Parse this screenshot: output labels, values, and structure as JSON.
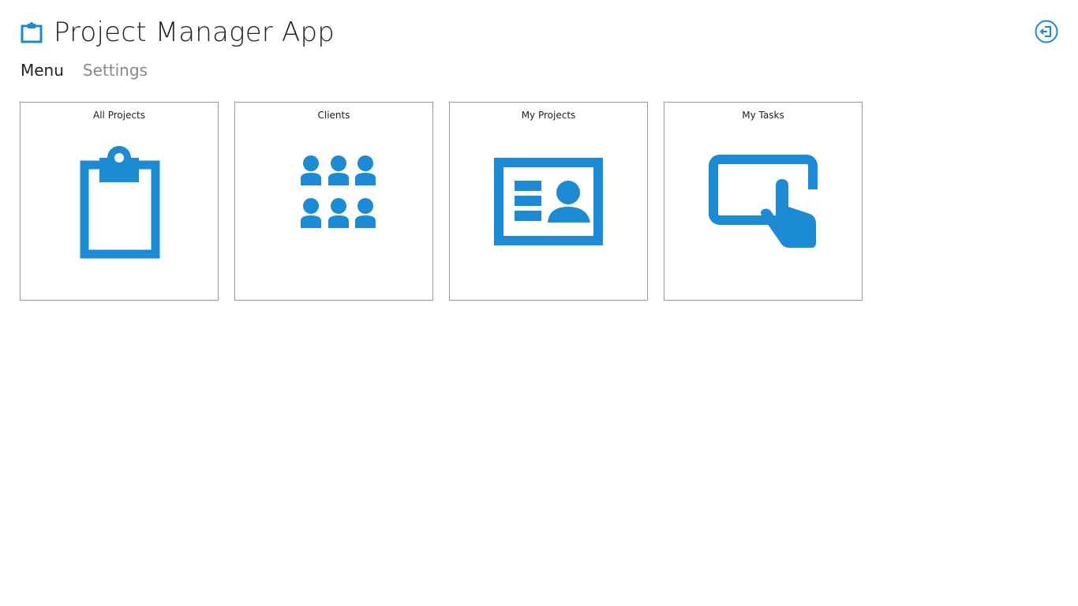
{
  "app": {
    "title": "Project Manager App",
    "accent_color": "#1a8bd4",
    "logo_icon": "clipboard-icon"
  },
  "nav": {
    "items": [
      {
        "label": "Menu",
        "active": true
      },
      {
        "label": "Settings",
        "active": false
      }
    ]
  },
  "header": {
    "logout_icon": "sign-out-icon"
  },
  "tiles": [
    {
      "label": "All Projects",
      "icon": "clipboard-icon"
    },
    {
      "label": "Clients",
      "icon": "people-group-icon"
    },
    {
      "label": "My Projects",
      "icon": "contact-card-icon"
    },
    {
      "label": "My Tasks",
      "icon": "touch-screen-icon"
    }
  ]
}
